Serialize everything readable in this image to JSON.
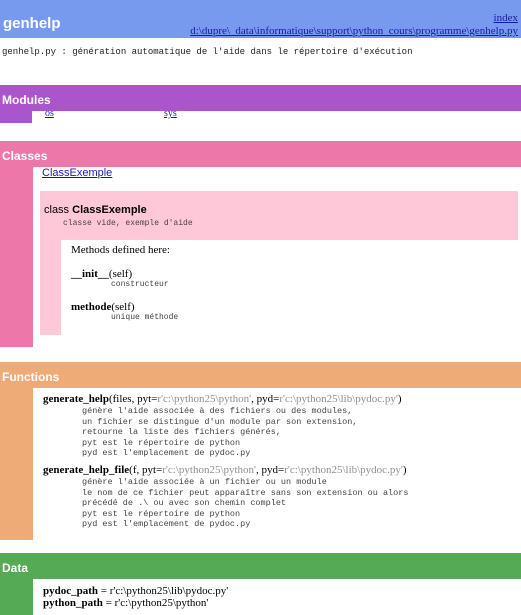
{
  "header": {
    "title": "genhelp",
    "index_link": "index",
    "path_link": "d:\\dupre\\_data\\informatique\\support\\python_cours\\programme\\genhelp.py"
  },
  "summary": "genhelp.py : génération automatique de l'aide dans le répertoire d'exécution",
  "modules": {
    "title": "Modules",
    "items": [
      "os",
      "sys"
    ]
  },
  "classes": {
    "title": "Classes",
    "link": "ClassExemple",
    "class_keyword": "class",
    "class_name": "ClassExemple",
    "class_doc": "classe vide, exemple d'aide",
    "methods_label": "Methods defined here:",
    "methods": [
      {
        "name": "__init__",
        "args": "(self)",
        "doc": "constructeur"
      },
      {
        "name": "methode",
        "args": "(self)",
        "doc": "unique méthode"
      }
    ]
  },
  "functions": {
    "title": "Functions",
    "items": [
      {
        "name": "generate_help",
        "args_start": "(files, pyt=",
        "default1": "r'c:\\python25\\python'",
        "args_mid": ", pyd=",
        "default2": "r'c:\\python25\\lib\\pydoc.py'",
        "args_end": ")",
        "doc": [
          "génère l'aide associée à des fichiers ou des modules,",
          "un fichier se distingue d'un module par son extension,",
          "retourne la liste des fichiers générés,",
          "pyt est le répertoire de python",
          "pyd est l'emplacement de pydoc.py"
        ]
      },
      {
        "name": "generate_help_file",
        "args_start": "(f, pyt=",
        "default1": "r'c:\\python25\\python'",
        "args_mid": ", pyd=",
        "default2": "r'c:\\python25\\lib\\pydoc.py'",
        "args_end": ")",
        "doc": [
          "génère l'aide associée à un fichier ou un module",
          "le nom de ce fichier peut apparaître sans son extension ou alors",
          "précédé de .\\ ou avec son chemin complet",
          "pyt est le répertoire de python",
          "pyd est l'emplacement de pydoc.py"
        ]
      }
    ]
  },
  "data": {
    "title": "Data",
    "items": [
      {
        "name": "pydoc_path",
        "value": " = r'c:\\python25\\lib\\pydoc.py'"
      },
      {
        "name": "python_path",
        "value": " = r'c:\\python25\\python'"
      }
    ]
  },
  "colors": {
    "header": "#7799ee",
    "modules": "#aa55cc",
    "classes": "#ee77aa",
    "class_box": "#ffc8d8",
    "functions": "#eeaa77",
    "data": "#55aa55"
  }
}
